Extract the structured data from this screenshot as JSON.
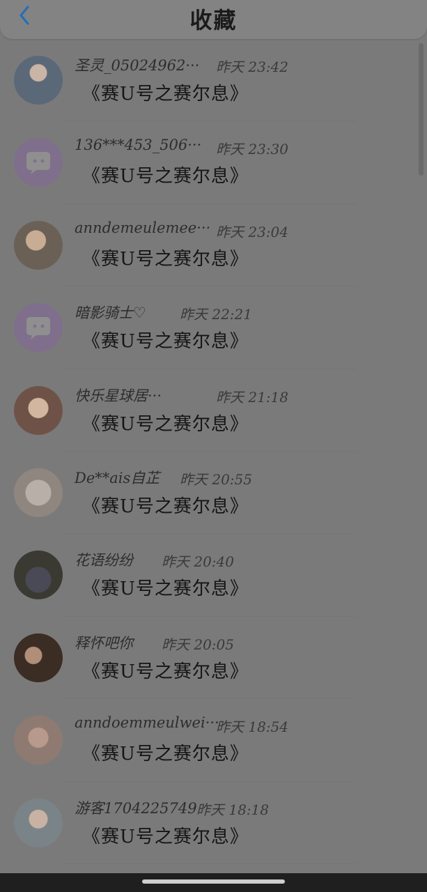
{
  "header": {
    "title": "收藏",
    "back_icon": "chevron-left-icon",
    "back_color": "#1f6fb8"
  },
  "items": [
    {
      "name": "圣灵_05024962···",
      "time": "昨天 23:42",
      "message": "《赛U号之赛尔息》",
      "avatar": "photo"
    },
    {
      "name": "136***453_506···",
      "time": "昨天 23:30",
      "message": "《赛U号之赛尔息》",
      "avatar": "chat-bubble-icon"
    },
    {
      "name": "anndemeulemee···",
      "time": "昨天 23:04",
      "message": "《赛U号之赛尔息》",
      "avatar": "photo"
    },
    {
      "name": "暗影骑士♡",
      "time": "昨天 22:21",
      "message": "《赛U号之赛尔息》",
      "avatar": "chat-bubble-icon"
    },
    {
      "name": "快乐星球居···",
      "time": "昨天 21:18",
      "message": "《赛U号之赛尔息》",
      "avatar": "photo"
    },
    {
      "name": "De**ais自芷",
      "time": "昨天 20:55",
      "message": "《赛U号之赛尔息》",
      "avatar": "photo"
    },
    {
      "name": "花语纷纷",
      "time": "昨天 20:40",
      "message": "《赛U号之赛尔息》",
      "avatar": "photo"
    },
    {
      "name": "释怀吧你",
      "time": "昨天 20:05",
      "message": "《赛U号之赛尔息》",
      "avatar": "photo"
    },
    {
      "name": "anndoemmeulwei···",
      "time": "昨天 18:54",
      "message": "《赛U号之赛尔息》",
      "avatar": "photo"
    },
    {
      "name": "游客1704225749",
      "time": "昨天 18:18",
      "message": "《赛U号之赛尔息》",
      "avatar": "photo"
    }
  ],
  "colors": {
    "overlay": "#7a7a7a",
    "chat_avatar": "#7f6f8c",
    "text_primary": "#151515"
  }
}
